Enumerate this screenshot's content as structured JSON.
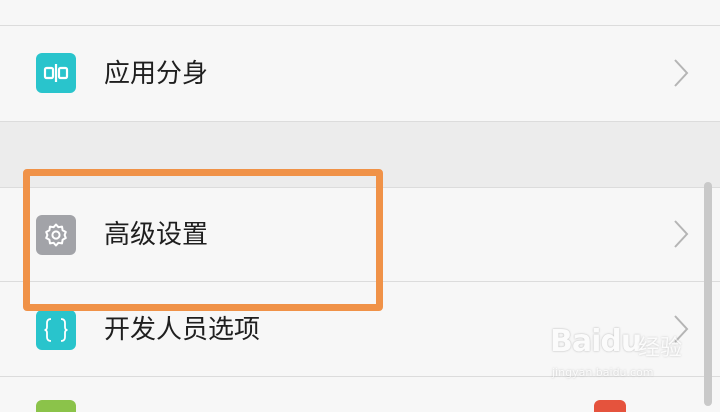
{
  "settings": {
    "items": [
      {
        "label": "应用分身",
        "icon": "app-clone-icon",
        "icon_color": "#29c4cc"
      },
      {
        "label": "高级设置",
        "icon": "gear-icon",
        "icon_color": "#a2a3a8"
      },
      {
        "label": "开发人员选项",
        "icon": "code-braces-icon",
        "icon_color": "#29c4cc"
      }
    ]
  },
  "colors": {
    "background": "#f7f7f7",
    "section_gap": "#ececec",
    "highlight": "#f09248",
    "chevron": "#b5b5b5"
  },
  "watermark": {
    "brand": "Baidu",
    "brand_cn": "经验",
    "url": "jingyan.baidu.com"
  }
}
